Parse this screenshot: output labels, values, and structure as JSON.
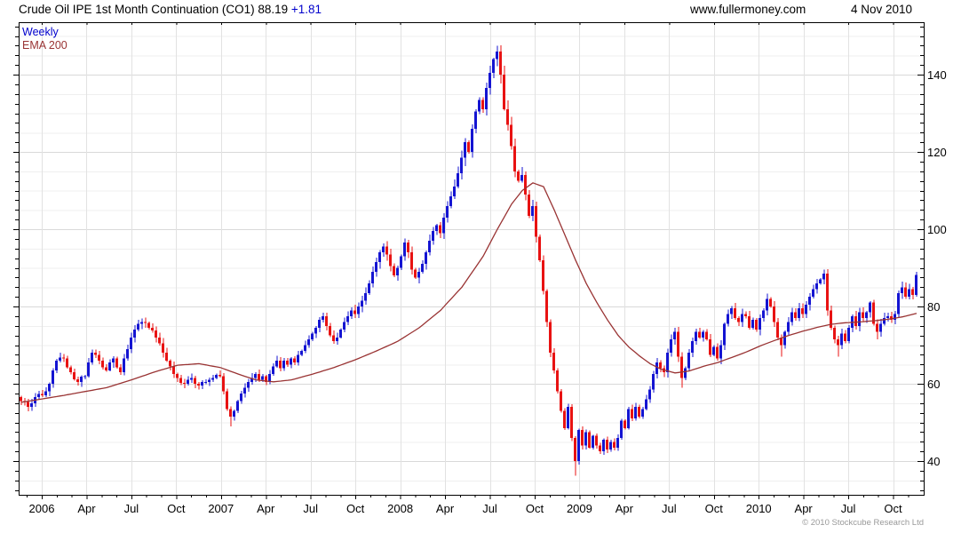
{
  "header": {
    "title": "Crude Oil IPE 1st Month Continuation (CO1) 88.19 ",
    "change": "+1.81",
    "website": "www.fullermoney.com",
    "date": "4 Nov 2010"
  },
  "legend": {
    "weekly": "Weekly",
    "ema": "EMA 200"
  },
  "copyright": "© 2010 Stockcube Research Ltd",
  "colors": {
    "up": "#1414d2",
    "down": "#e81212",
    "ema": "#993333",
    "grid_minor": "#efefef",
    "grid_major": "#d9d9d9",
    "grid_vert": "#e2e2e2",
    "axis": "#000000",
    "label": "#000000",
    "legend_weekly": "#0000cc",
    "legend_ema": "#993333",
    "change_text": "#0000cc",
    "copyright_text": "#999999"
  },
  "chart_data": {
    "type": "candlestick",
    "instrument": "Crude Oil IPE 1st Month Continuation (CO1)",
    "interval": "Weekly",
    "overlay": "EMA 200",
    "last_close": 88.19,
    "change": 1.81,
    "x_axis": {
      "labels": [
        "2006",
        "Apr",
        "Jul",
        "Oct",
        "2007",
        "Apr",
        "Jul",
        "Oct",
        "2008",
        "Apr",
        "Jul",
        "Oct",
        "2009",
        "Apr",
        "Jul",
        "Oct",
        "2010",
        "Apr",
        "Jul",
        "Oct"
      ]
    },
    "y_axis": {
      "tick_labels": [
        40,
        60,
        80,
        100,
        120,
        140
      ],
      "minor_grid_step": 5,
      "minor_tick_step": 2.5,
      "visible_price_range": [
        31,
        153
      ]
    },
    "first_open": 56.5,
    "weekly_closes": [
      55.5,
      55.3,
      54.0,
      55.0,
      56.5,
      57.3,
      57.0,
      58.0,
      60.0,
      63.5,
      66.0,
      66.8,
      66.5,
      64.3,
      63.0,
      61.2,
      60.5,
      61.8,
      62.0,
      65.5,
      68.0,
      67.5,
      66.0,
      64.2,
      63.5,
      65.5,
      66.5,
      64.3,
      63.0,
      66.5,
      69.0,
      72.0,
      74.0,
      75.5,
      76.0,
      75.8,
      74.5,
      73.8,
      72.0,
      70.5,
      68.0,
      66.0,
      64.5,
      62.5,
      61.5,
      60.2,
      60.0,
      61.0,
      61.5,
      60.0,
      59.5,
      60.5,
      60.5,
      61.0,
      61.5,
      62.3,
      62.0,
      58.0,
      53.5,
      51.5,
      53.0,
      55.5,
      57.5,
      59.0,
      60.5,
      61.5,
      62.5,
      61.0,
      62.0,
      60.5,
      62.5,
      64.5,
      66.0,
      64.0,
      66.0,
      65.0,
      66.5,
      65.5,
      67.5,
      68.5,
      70.0,
      71.5,
      73.0,
      74.5,
      76.5,
      77.5,
      75.0,
      72.5,
      71.0,
      72.0,
      74.0,
      76.0,
      77.5,
      79.0,
      78.0,
      80.0,
      81.5,
      83.5,
      86.0,
      89.0,
      91.5,
      94.0,
      95.5,
      93.5,
      90.5,
      88.0,
      90.0,
      93.0,
      96.5,
      94.0,
      89.5,
      87.5,
      89.0,
      91.0,
      94.0,
      97.0,
      99.5,
      101.0,
      99.0,
      103.0,
      106.0,
      108.5,
      111.0,
      114.5,
      118.5,
      122.5,
      120.0,
      126.0,
      130.5,
      133.5,
      131.0,
      136.5,
      140.5,
      144.0,
      146.0,
      140.0,
      131.0,
      127.0,
      121.5,
      115.0,
      112.5,
      114.0,
      109.0,
      103.5,
      106.0,
      98.0,
      92.0,
      84.0,
      76.0,
      68.0,
      63.5,
      58.0,
      53.0,
      48.5,
      54.0,
      46.0,
      40.0,
      48.0,
      44.0,
      47.5,
      43.5,
      46.5,
      44.0,
      42.5,
      45.5,
      43.0,
      45.0,
      43.5,
      46.0,
      50.5,
      48.5,
      53.5,
      51.0,
      54.0,
      51.5,
      53.5,
      56.0,
      58.5,
      62.5,
      65.5,
      64.0,
      63.0,
      68.0,
      71.5,
      73.5,
      67.0,
      61.5,
      64.0,
      68.0,
      71.0,
      73.5,
      72.0,
      73.5,
      71.5,
      67.5,
      69.5,
      66.5,
      70.0,
      75.5,
      78.0,
      79.5,
      77.0,
      76.0,
      78.0,
      77.5,
      74.5,
      76.5,
      74.0,
      77.0,
      79.0,
      82.0,
      80.0,
      76.0,
      72.0,
      70.0,
      73.5,
      76.0,
      78.5,
      77.0,
      79.5,
      78.0,
      80.5,
      82.5,
      84.5,
      86.0,
      87.0,
      88.5,
      79.0,
      74.5,
      71.5,
      70.0,
      73.0,
      71.0,
      74.5,
      77.5,
      75.0,
      78.5,
      77.0,
      78.5,
      81.0,
      75.5,
      73.5,
      75.5,
      77.0,
      77.5,
      76.5,
      78.0,
      83.5,
      85.0,
      82.5,
      84.5,
      83.0,
      88.2
    ],
    "wick_overrides": {
      "59": {
        "low": 49.0
      },
      "134": {
        "high": 147.5
      },
      "156": {
        "low": 36.2
      },
      "186": {
        "low": 59.0
      },
      "214": {
        "low": 67.0
      },
      "226": {
        "high": 89.5
      },
      "230": {
        "low": 67.0
      },
      "241": {
        "low": 71.5
      },
      "252": {
        "high": 89.0
      }
    },
    "ema200_anchors": [
      [
        0,
        55.2
      ],
      [
        12,
        57.0
      ],
      [
        24,
        59.0
      ],
      [
        31,
        61.0
      ],
      [
        38,
        63.2
      ],
      [
        44,
        64.8
      ],
      [
        50,
        65.2
      ],
      [
        56,
        64.2
      ],
      [
        62,
        62.2
      ],
      [
        66,
        61.0
      ],
      [
        71,
        60.5
      ],
      [
        76,
        61.0
      ],
      [
        82,
        62.5
      ],
      [
        88,
        64.2
      ],
      [
        94,
        66.2
      ],
      [
        100,
        68.5
      ],
      [
        106,
        71.0
      ],
      [
        112,
        74.5
      ],
      [
        118,
        79.0
      ],
      [
        124,
        85.0
      ],
      [
        130,
        93.0
      ],
      [
        134,
        100.0
      ],
      [
        138,
        106.5
      ],
      [
        141,
        110.0
      ],
      [
        144,
        112.0
      ],
      [
        147,
        111.0
      ],
      [
        150,
        105.0
      ],
      [
        153,
        98.5
      ],
      [
        156,
        92.0
      ],
      [
        159,
        86.0
      ],
      [
        162,
        81.0
      ],
      [
        165,
        76.5
      ],
      [
        168,
        72.5
      ],
      [
        171,
        69.5
      ],
      [
        174,
        67.2
      ],
      [
        177,
        65.2
      ],
      [
        180,
        63.8
      ],
      [
        184,
        62.8
      ],
      [
        188,
        63.3
      ],
      [
        192,
        64.5
      ],
      [
        196,
        65.5
      ],
      [
        200,
        66.8
      ],
      [
        204,
        68.2
      ],
      [
        208,
        69.8
      ],
      [
        212,
        71.2
      ],
      [
        216,
        72.5
      ],
      [
        220,
        73.6
      ],
      [
        224,
        74.6
      ],
      [
        228,
        75.4
      ],
      [
        232,
        75.8
      ],
      [
        236,
        76.0
      ],
      [
        240,
        76.3
      ],
      [
        244,
        76.7
      ],
      [
        248,
        77.3
      ],
      [
        252,
        78.2
      ]
    ]
  }
}
